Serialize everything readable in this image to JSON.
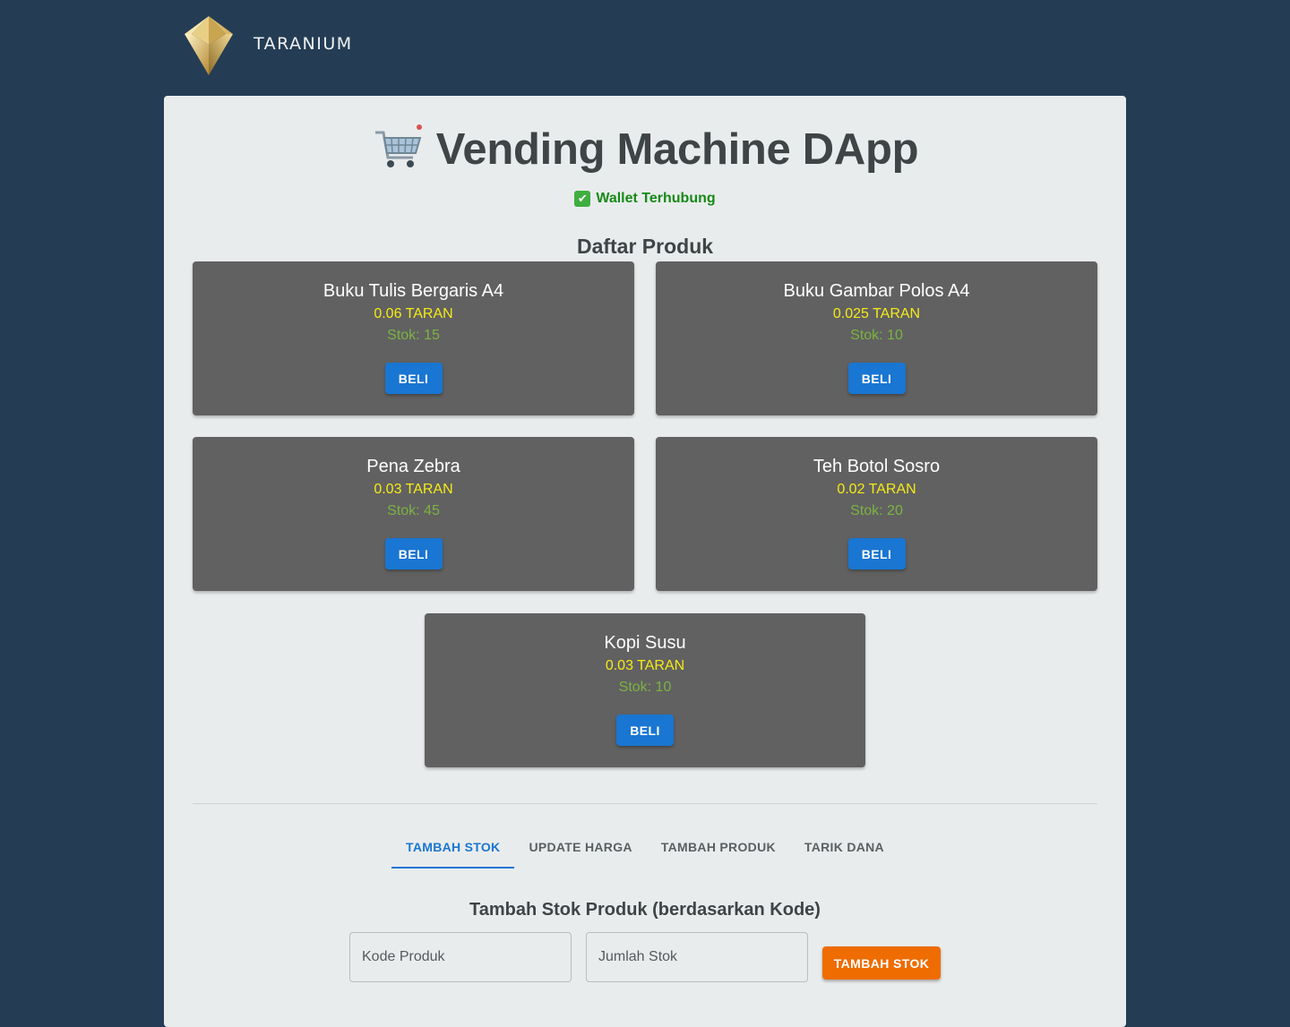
{
  "brand": {
    "name": "TARANIUM",
    "logo_icon": "diamond-gem-icon"
  },
  "header": {
    "cart_icon": "shopping-cart-icon",
    "title": "Vending Machine DApp"
  },
  "wallet": {
    "check_icon": "check-mark-icon",
    "status": "Wallet Terhubung",
    "status_color": "#168a16"
  },
  "products_section": {
    "title": "Daftar Produk"
  },
  "products": [
    {
      "name": "Buku Tulis Bergaris A4",
      "price": "0.06 TARAN",
      "stock": "Stok: 15",
      "buy_label": "BELI"
    },
    {
      "name": "Buku Gambar Polos A4",
      "price": "0.025 TARAN",
      "stock": "Stok: 10",
      "buy_label": "BELI"
    },
    {
      "name": "Pena Zebra",
      "price": "0.03 TARAN",
      "stock": "Stok: 45",
      "buy_label": "BELI"
    },
    {
      "name": "Teh Botol Sosro",
      "price": "0.02 TARAN",
      "stock": "Stok: 20",
      "buy_label": "BELI"
    },
    {
      "name": "Kopi Susu",
      "price": "0.03 TARAN",
      "stock": "Stok: 10",
      "buy_label": "BELI"
    }
  ],
  "tabs": [
    {
      "label": "TAMBAH STOK",
      "active": true
    },
    {
      "label": "UPDATE HARGA",
      "active": false
    },
    {
      "label": "TAMBAH PRODUK",
      "active": false
    },
    {
      "label": "TARIK DANA",
      "active": false
    }
  ],
  "form": {
    "title": "Tambah Stok Produk (berdasarkan Kode)",
    "code_placeholder": "Kode Produk",
    "code_value": "",
    "amount_placeholder": "Jumlah Stok",
    "amount_value": "",
    "submit_label": "TAMBAH STOK"
  },
  "colors": {
    "background": "#243d55",
    "panel": "#e9eced",
    "card": "#616161",
    "price": "#f5ea17",
    "stock": "#7cb342",
    "primary": "#1976d2",
    "accent": "#ef6c00"
  }
}
